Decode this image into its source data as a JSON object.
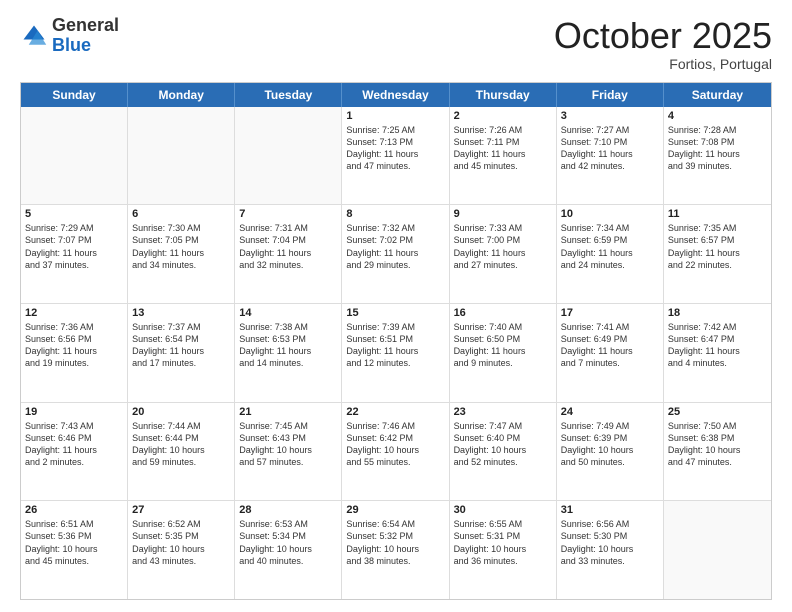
{
  "header": {
    "logo_general": "General",
    "logo_blue": "Blue",
    "month": "October 2025",
    "location": "Fortios, Portugal"
  },
  "days_of_week": [
    "Sunday",
    "Monday",
    "Tuesday",
    "Wednesday",
    "Thursday",
    "Friday",
    "Saturday"
  ],
  "rows": [
    [
      {
        "day": "",
        "lines": []
      },
      {
        "day": "",
        "lines": []
      },
      {
        "day": "",
        "lines": []
      },
      {
        "day": "1",
        "lines": [
          "Sunrise: 7:25 AM",
          "Sunset: 7:13 PM",
          "Daylight: 11 hours",
          "and 47 minutes."
        ]
      },
      {
        "day": "2",
        "lines": [
          "Sunrise: 7:26 AM",
          "Sunset: 7:11 PM",
          "Daylight: 11 hours",
          "and 45 minutes."
        ]
      },
      {
        "day": "3",
        "lines": [
          "Sunrise: 7:27 AM",
          "Sunset: 7:10 PM",
          "Daylight: 11 hours",
          "and 42 minutes."
        ]
      },
      {
        "day": "4",
        "lines": [
          "Sunrise: 7:28 AM",
          "Sunset: 7:08 PM",
          "Daylight: 11 hours",
          "and 39 minutes."
        ]
      }
    ],
    [
      {
        "day": "5",
        "lines": [
          "Sunrise: 7:29 AM",
          "Sunset: 7:07 PM",
          "Daylight: 11 hours",
          "and 37 minutes."
        ]
      },
      {
        "day": "6",
        "lines": [
          "Sunrise: 7:30 AM",
          "Sunset: 7:05 PM",
          "Daylight: 11 hours",
          "and 34 minutes."
        ]
      },
      {
        "day": "7",
        "lines": [
          "Sunrise: 7:31 AM",
          "Sunset: 7:04 PM",
          "Daylight: 11 hours",
          "and 32 minutes."
        ]
      },
      {
        "day": "8",
        "lines": [
          "Sunrise: 7:32 AM",
          "Sunset: 7:02 PM",
          "Daylight: 11 hours",
          "and 29 minutes."
        ]
      },
      {
        "day": "9",
        "lines": [
          "Sunrise: 7:33 AM",
          "Sunset: 7:00 PM",
          "Daylight: 11 hours",
          "and 27 minutes."
        ]
      },
      {
        "day": "10",
        "lines": [
          "Sunrise: 7:34 AM",
          "Sunset: 6:59 PM",
          "Daylight: 11 hours",
          "and 24 minutes."
        ]
      },
      {
        "day": "11",
        "lines": [
          "Sunrise: 7:35 AM",
          "Sunset: 6:57 PM",
          "Daylight: 11 hours",
          "and 22 minutes."
        ]
      }
    ],
    [
      {
        "day": "12",
        "lines": [
          "Sunrise: 7:36 AM",
          "Sunset: 6:56 PM",
          "Daylight: 11 hours",
          "and 19 minutes."
        ]
      },
      {
        "day": "13",
        "lines": [
          "Sunrise: 7:37 AM",
          "Sunset: 6:54 PM",
          "Daylight: 11 hours",
          "and 17 minutes."
        ]
      },
      {
        "day": "14",
        "lines": [
          "Sunrise: 7:38 AM",
          "Sunset: 6:53 PM",
          "Daylight: 11 hours",
          "and 14 minutes."
        ]
      },
      {
        "day": "15",
        "lines": [
          "Sunrise: 7:39 AM",
          "Sunset: 6:51 PM",
          "Daylight: 11 hours",
          "and 12 minutes."
        ]
      },
      {
        "day": "16",
        "lines": [
          "Sunrise: 7:40 AM",
          "Sunset: 6:50 PM",
          "Daylight: 11 hours",
          "and 9 minutes."
        ]
      },
      {
        "day": "17",
        "lines": [
          "Sunrise: 7:41 AM",
          "Sunset: 6:49 PM",
          "Daylight: 11 hours",
          "and 7 minutes."
        ]
      },
      {
        "day": "18",
        "lines": [
          "Sunrise: 7:42 AM",
          "Sunset: 6:47 PM",
          "Daylight: 11 hours",
          "and 4 minutes."
        ]
      }
    ],
    [
      {
        "day": "19",
        "lines": [
          "Sunrise: 7:43 AM",
          "Sunset: 6:46 PM",
          "Daylight: 11 hours",
          "and 2 minutes."
        ]
      },
      {
        "day": "20",
        "lines": [
          "Sunrise: 7:44 AM",
          "Sunset: 6:44 PM",
          "Daylight: 10 hours",
          "and 59 minutes."
        ]
      },
      {
        "day": "21",
        "lines": [
          "Sunrise: 7:45 AM",
          "Sunset: 6:43 PM",
          "Daylight: 10 hours",
          "and 57 minutes."
        ]
      },
      {
        "day": "22",
        "lines": [
          "Sunrise: 7:46 AM",
          "Sunset: 6:42 PM",
          "Daylight: 10 hours",
          "and 55 minutes."
        ]
      },
      {
        "day": "23",
        "lines": [
          "Sunrise: 7:47 AM",
          "Sunset: 6:40 PM",
          "Daylight: 10 hours",
          "and 52 minutes."
        ]
      },
      {
        "day": "24",
        "lines": [
          "Sunrise: 7:49 AM",
          "Sunset: 6:39 PM",
          "Daylight: 10 hours",
          "and 50 minutes."
        ]
      },
      {
        "day": "25",
        "lines": [
          "Sunrise: 7:50 AM",
          "Sunset: 6:38 PM",
          "Daylight: 10 hours",
          "and 47 minutes."
        ]
      }
    ],
    [
      {
        "day": "26",
        "lines": [
          "Sunrise: 6:51 AM",
          "Sunset: 5:36 PM",
          "Daylight: 10 hours",
          "and 45 minutes."
        ]
      },
      {
        "day": "27",
        "lines": [
          "Sunrise: 6:52 AM",
          "Sunset: 5:35 PM",
          "Daylight: 10 hours",
          "and 43 minutes."
        ]
      },
      {
        "day": "28",
        "lines": [
          "Sunrise: 6:53 AM",
          "Sunset: 5:34 PM",
          "Daylight: 10 hours",
          "and 40 minutes."
        ]
      },
      {
        "day": "29",
        "lines": [
          "Sunrise: 6:54 AM",
          "Sunset: 5:32 PM",
          "Daylight: 10 hours",
          "and 38 minutes."
        ]
      },
      {
        "day": "30",
        "lines": [
          "Sunrise: 6:55 AM",
          "Sunset: 5:31 PM",
          "Daylight: 10 hours",
          "and 36 minutes."
        ]
      },
      {
        "day": "31",
        "lines": [
          "Sunrise: 6:56 AM",
          "Sunset: 5:30 PM",
          "Daylight: 10 hours",
          "and 33 minutes."
        ]
      },
      {
        "day": "",
        "lines": []
      }
    ]
  ]
}
